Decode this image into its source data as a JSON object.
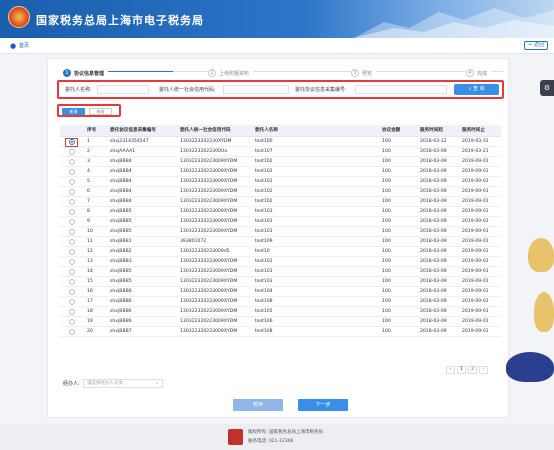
{
  "header": {
    "title": "国家税务总局上海市电子税务局"
  },
  "breadcrumb": {
    "home": "首页",
    "back": "返回"
  },
  "steps": [
    {
      "num": "1",
      "label": "协议信息管理"
    },
    {
      "num": "2",
      "label": "上传附报资料"
    },
    {
      "num": "3",
      "label": "预览"
    },
    {
      "num": "4",
      "label": "完成"
    }
  ],
  "search": {
    "client_name_label": "委托人名称:",
    "client_code_label": "委托人统一社会信用代码:",
    "agreement_no_label": "委托协议信息采集编号:",
    "button": "查 询"
  },
  "toolbar": {
    "add": "新增",
    "edit": "修改"
  },
  "table": {
    "headers": [
      "序号",
      "委托协议信息采集编号",
      "委托人统一社会信用代码",
      "委托人名称",
      "协议金额",
      "服务时间起",
      "服务时间止"
    ],
    "rows": [
      [
        "1",
        "shxj2314354547",
        "1303223202230XYDM",
        "test100",
        "100",
        "2018-03-12",
        "2019-03-31"
      ],
      [
        "2",
        "shxjAAAA1",
        "13032232022300Ua",
        "test107",
        "100",
        "2018-03-09",
        "2019-03-21"
      ],
      [
        "3",
        "shxjBBB4",
        "130322320223009XYDM",
        "test102",
        "100",
        "2018-03-09",
        "2019-09-01"
      ],
      [
        "4",
        "shxjBBB4",
        "130322320223009XYDM",
        "test102",
        "100",
        "2018-03-09",
        "2019-09-01"
      ],
      [
        "5",
        "shxjBBB4",
        "130322320223009XYDM",
        "test102",
        "100",
        "2018-03-09",
        "2019-09-01"
      ],
      [
        "6",
        "shxjBBB4",
        "130322320223009XYDM",
        "test102",
        "100",
        "2018-03-09",
        "2019-09-01"
      ],
      [
        "7",
        "shxjBBB4",
        "130322320223009XYDM",
        "test102",
        "100",
        "2018-03-09",
        "2019-09-01"
      ],
      [
        "8",
        "shxjBBB5",
        "130322320223009XYDM",
        "test103",
        "100",
        "2018-03-09",
        "2019-09-01"
      ],
      [
        "9",
        "shxjBBB5",
        "130322320223009XYDM",
        "test103",
        "100",
        "2018-03-09",
        "2019-09-01"
      ],
      [
        "10",
        "shxjBBB5",
        "130322320223009XYDM",
        "test103",
        "100",
        "2018-03-09",
        "2019-09-01"
      ],
      [
        "11",
        "shxjBBB1",
        "393801072",
        "test109",
        "100",
        "2018-03-09",
        "2019-09-01"
      ],
      [
        "12",
        "shxjBBB2",
        "130322320223009d5",
        "test10",
        "100",
        "2018-03-09",
        "2019-09-01"
      ],
      [
        "13",
        "shxjBBB3",
        "130322320223009XYDM",
        "test102",
        "100",
        "2018-03-09",
        "2019-09-01"
      ],
      [
        "14",
        "shxjBBB5",
        "130322320223009XYDM",
        "test103",
        "100",
        "2018-03-09",
        "2019-09-01"
      ],
      [
        "15",
        "shxjBBB5",
        "130322320223009XYDM",
        "test103",
        "100",
        "2018-03-09",
        "2019-09-01"
      ],
      [
        "16",
        "shxjBBB6",
        "130322320223009XYDM",
        "test104",
        "100",
        "2018-03-09",
        "2019-09-01"
      ],
      [
        "17",
        "shxjBBB6",
        "130322320223009XYDM",
        "test108",
        "100",
        "2018-03-09",
        "2019-09-01"
      ],
      [
        "18",
        "shxjBBB6",
        "130322320223009XYDM",
        "test105",
        "100",
        "2018-03-09",
        "2019-09-01"
      ],
      [
        "19",
        "shxjBBB6",
        "130322320223009XYDM",
        "test106",
        "100",
        "2018-03-09",
        "2019-09-01"
      ],
      [
        "20",
        "shxjBBB7",
        "130322320223009XYDM",
        "test108",
        "100",
        "2018-03-09",
        "2019-09-01"
      ]
    ]
  },
  "pager": {
    "prev": "‹",
    "page1": "1",
    "page2": "2",
    "next": "›"
  },
  "agent": {
    "label": "经办人:",
    "placeholder": "请选择经办人员类"
  },
  "buttons": {
    "save": "暂存",
    "next": "下一步"
  },
  "footer": {
    "line1": "版权所有: 国家税务总局上海市税务局",
    "line2": "服务电话: 021-12366"
  },
  "colors": {
    "primary": "#3a8ee6",
    "header": "#1a5fae",
    "highlight": "#e23b3b"
  }
}
